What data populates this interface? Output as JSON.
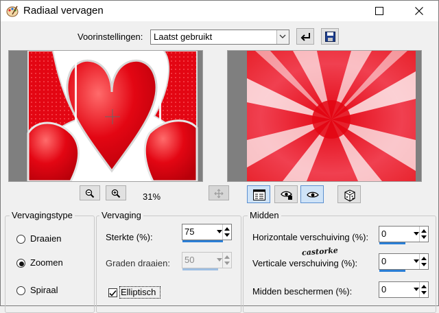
{
  "window": {
    "title": "Radiaal vervagen"
  },
  "presets": {
    "label": "Voorinstellingen:",
    "value": "Laatst gebruikt"
  },
  "zoom": {
    "level": "31%"
  },
  "blur_type": {
    "title": "Vervagingstype",
    "options": [
      {
        "label": "Draaien",
        "selected": false
      },
      {
        "label": "Zoomen",
        "selected": true
      },
      {
        "label": "Spiraal",
        "selected": false
      }
    ]
  },
  "blur": {
    "title": "Vervaging",
    "strength_label": "Sterkte (%):",
    "strength_value": "75",
    "rotate_label": "Graden draaien:",
    "rotate_value": "50",
    "elliptic_label": "Elliptisch",
    "elliptic_checked": true
  },
  "center": {
    "title": "Midden",
    "h_offset_label": "Horizontale verschuiving (%):",
    "h_offset_value": "0",
    "v_offset_label": "Verticale verschuiving (%):",
    "v_offset_value": "0",
    "protect_label": "Midden beschermen (%):",
    "protect_value": "0"
  },
  "watermark": {
    "text": "castorke"
  },
  "colors": {
    "accent": "#2b7fd6",
    "red": "#e30613"
  }
}
